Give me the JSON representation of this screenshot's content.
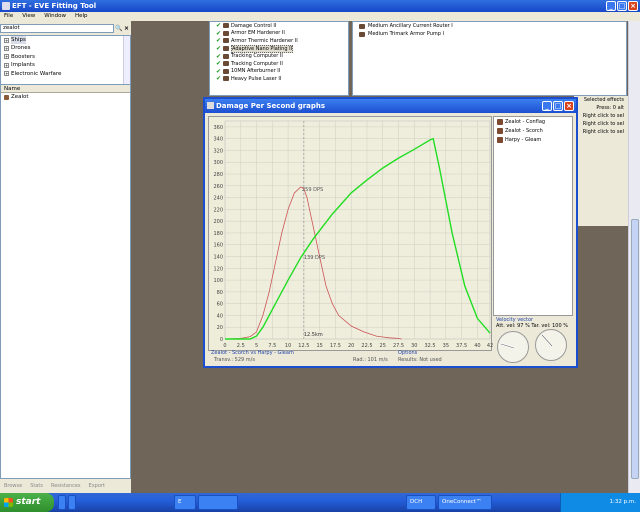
{
  "window": {
    "title": "EFT - EVE Fitting Tool"
  },
  "menu": [
    "File",
    "View",
    "Window",
    "Help"
  ],
  "search": {
    "value": "zealot"
  },
  "tree": [
    {
      "label": "Ships",
      "selected": true
    },
    {
      "label": "Drones"
    },
    {
      "label": "Boosters"
    },
    {
      "label": "Implants"
    },
    {
      "label": "Electronic Warfare"
    }
  ],
  "results": {
    "header": "Name",
    "items": [
      "Zealot"
    ]
  },
  "bottom_tabs": [
    "Browse",
    "Stats",
    "Resistances",
    "Export"
  ],
  "fitting": [
    "Damage Control II",
    "Armor EM Hardener II",
    "Armor Thermic Hardener II",
    "Adaptive Nano Plating II",
    "Tracking Computer II",
    "Tracking Computer II",
    "10MN Afterburner II",
    "Heavy Pulse Laser II"
  ],
  "slots": [
    "Medium Ancillary Current Router I",
    "Medium Trimark Armor Pump I"
  ],
  "right_panel": {
    "header": "Selected effects",
    "lines": [
      "Press: 0 alt",
      "Right click to sel",
      "Right click to sel",
      "Right click to sel"
    ]
  },
  "graph_window": {
    "title": "Damage Per Second graphs",
    "legend": [
      "Zealot - Conflag",
      "Zealot - Scorch",
      "Harpy - Gleam"
    ],
    "velocity": {
      "label": "Velocity vector",
      "a": "Att. vel: 97 %",
      "b": "Tar. vel: 100 %"
    },
    "info": {
      "matchup": "Zealot - Scorch vs Harpy - Gleam",
      "transv": "Transv.: 529 m/s",
      "rad": "Rad.: 101 m/s",
      "options": "Options",
      "options_sub": "Results: Not used"
    },
    "annotations": {
      "peak_label": "259 DPS",
      "mid_label": "139 DPS",
      "range_label": "12.5km"
    }
  },
  "chart_data": {
    "type": "line",
    "x_ticks": [
      "0",
      "2.5",
      "5",
      "7.5",
      "10",
      "12.5",
      "15",
      "17.5",
      "20",
      "22.5",
      "25",
      "27.5",
      "30",
      "32.5",
      "35",
      "37.5",
      "40",
      "42"
    ],
    "y_ticks": [
      "0",
      "20",
      "40",
      "60",
      "80",
      "100",
      "120",
      "140",
      "160",
      "180",
      "200",
      "220",
      "240",
      "260",
      "280",
      "300",
      "320",
      "340",
      "360"
    ],
    "xlim": [
      0,
      42
    ],
    "ylim": [
      0,
      370
    ],
    "series": [
      {
        "color": "#cc5555",
        "x": [
          0,
          2.5,
          4,
          5,
          6,
          7,
          8,
          9,
          10,
          11,
          12,
          12.5,
          13,
          14,
          15,
          16,
          17,
          18,
          20,
          22,
          24,
          26,
          27.5,
          28
        ],
        "y": [
          0,
          1,
          4,
          12,
          40,
          80,
          130,
          180,
          220,
          248,
          258,
          255,
          240,
          190,
          140,
          90,
          60,
          40,
          22,
          12,
          5,
          2,
          1,
          0
        ]
      },
      {
        "color": "#22dd22",
        "x": [
          0,
          4,
          5,
          6,
          8,
          10,
          12,
          14,
          17,
          20,
          22.5,
          25,
          27.5,
          30,
          32.5,
          33,
          34,
          36,
          38,
          40,
          42
        ],
        "y": [
          0,
          0,
          5,
          20,
          60,
          100,
          138,
          170,
          212,
          248,
          270,
          290,
          307,
          322,
          338,
          340,
          290,
          180,
          90,
          35,
          10
        ]
      }
    ]
  },
  "taskbar": {
    "start": "start",
    "buttons": [
      "E",
      "",
      "",
      "",
      "",
      "DCH",
      "OneConnect™"
    ],
    "clock": "1:32 p.m."
  }
}
